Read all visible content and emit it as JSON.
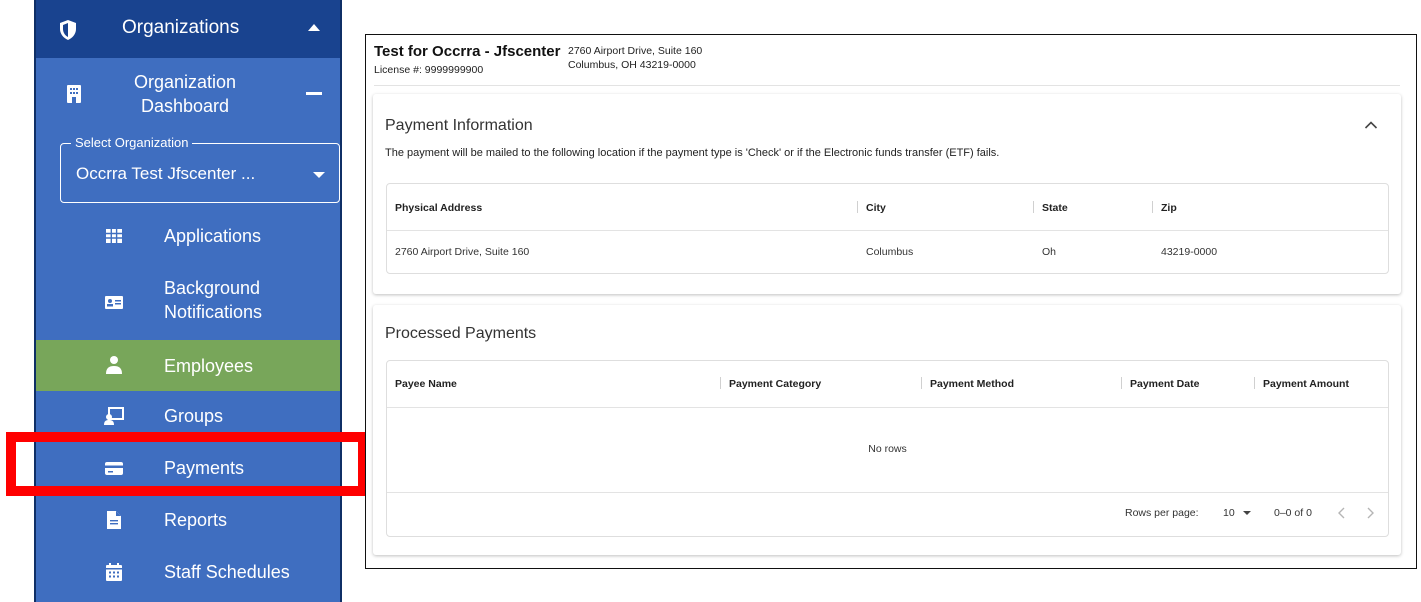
{
  "sidebar": {
    "header": {
      "label": "Organizations",
      "icon": "shield-icon"
    },
    "dashboard": {
      "label": "Organization Dashboard",
      "icon": "building-icon"
    },
    "select": {
      "legend": "Select Organization",
      "value": "Occrra Test Jfscenter ..."
    },
    "items": [
      {
        "label": "Applications",
        "icon": "table-grid-icon"
      },
      {
        "label": "Background Notifications",
        "icon": "id-card-icon"
      },
      {
        "label": "Employees",
        "icon": "person-icon",
        "active": true
      },
      {
        "label": "Groups",
        "icon": "presentation-icon"
      },
      {
        "label": "Payments",
        "icon": "credit-card-icon"
      },
      {
        "label": "Reports",
        "icon": "document-icon"
      },
      {
        "label": "Staff Schedules",
        "icon": "calendar-icon"
      }
    ]
  },
  "org": {
    "name": "Test for Occrra - Jfscenter",
    "license": "License #: 9999999900",
    "address_line1": "2760 Airport Drive, Suite 160",
    "address_line2": "Columbus, OH 43219-0000"
  },
  "payment_info": {
    "title": "Payment Information",
    "description": "The payment will be mailed to the following location if the payment type is 'Check' or if the Electronic funds transfer (ETF) fails.",
    "columns": [
      "Physical Address",
      "City",
      "State",
      "Zip"
    ],
    "rows": [
      [
        "2760 Airport Drive, Suite 160",
        "Columbus",
        "Oh",
        "43219-0000"
      ]
    ]
  },
  "processed_payments": {
    "title": "Processed Payments",
    "columns": [
      "Payee Name",
      "Payment Category",
      "Payment Method",
      "Payment Date",
      "Payment Amount"
    ],
    "empty_text": "No rows",
    "rows_per_page_label": "Rows per page:",
    "rows_per_page_value": "10",
    "range_text": "0–0 of 0"
  },
  "colors": {
    "sidebar_bg": "#3f6ec0",
    "sidebar_header_bg": "#19438f",
    "active_item_bg": "#78a65a",
    "highlight_border": "#ff0000"
  }
}
